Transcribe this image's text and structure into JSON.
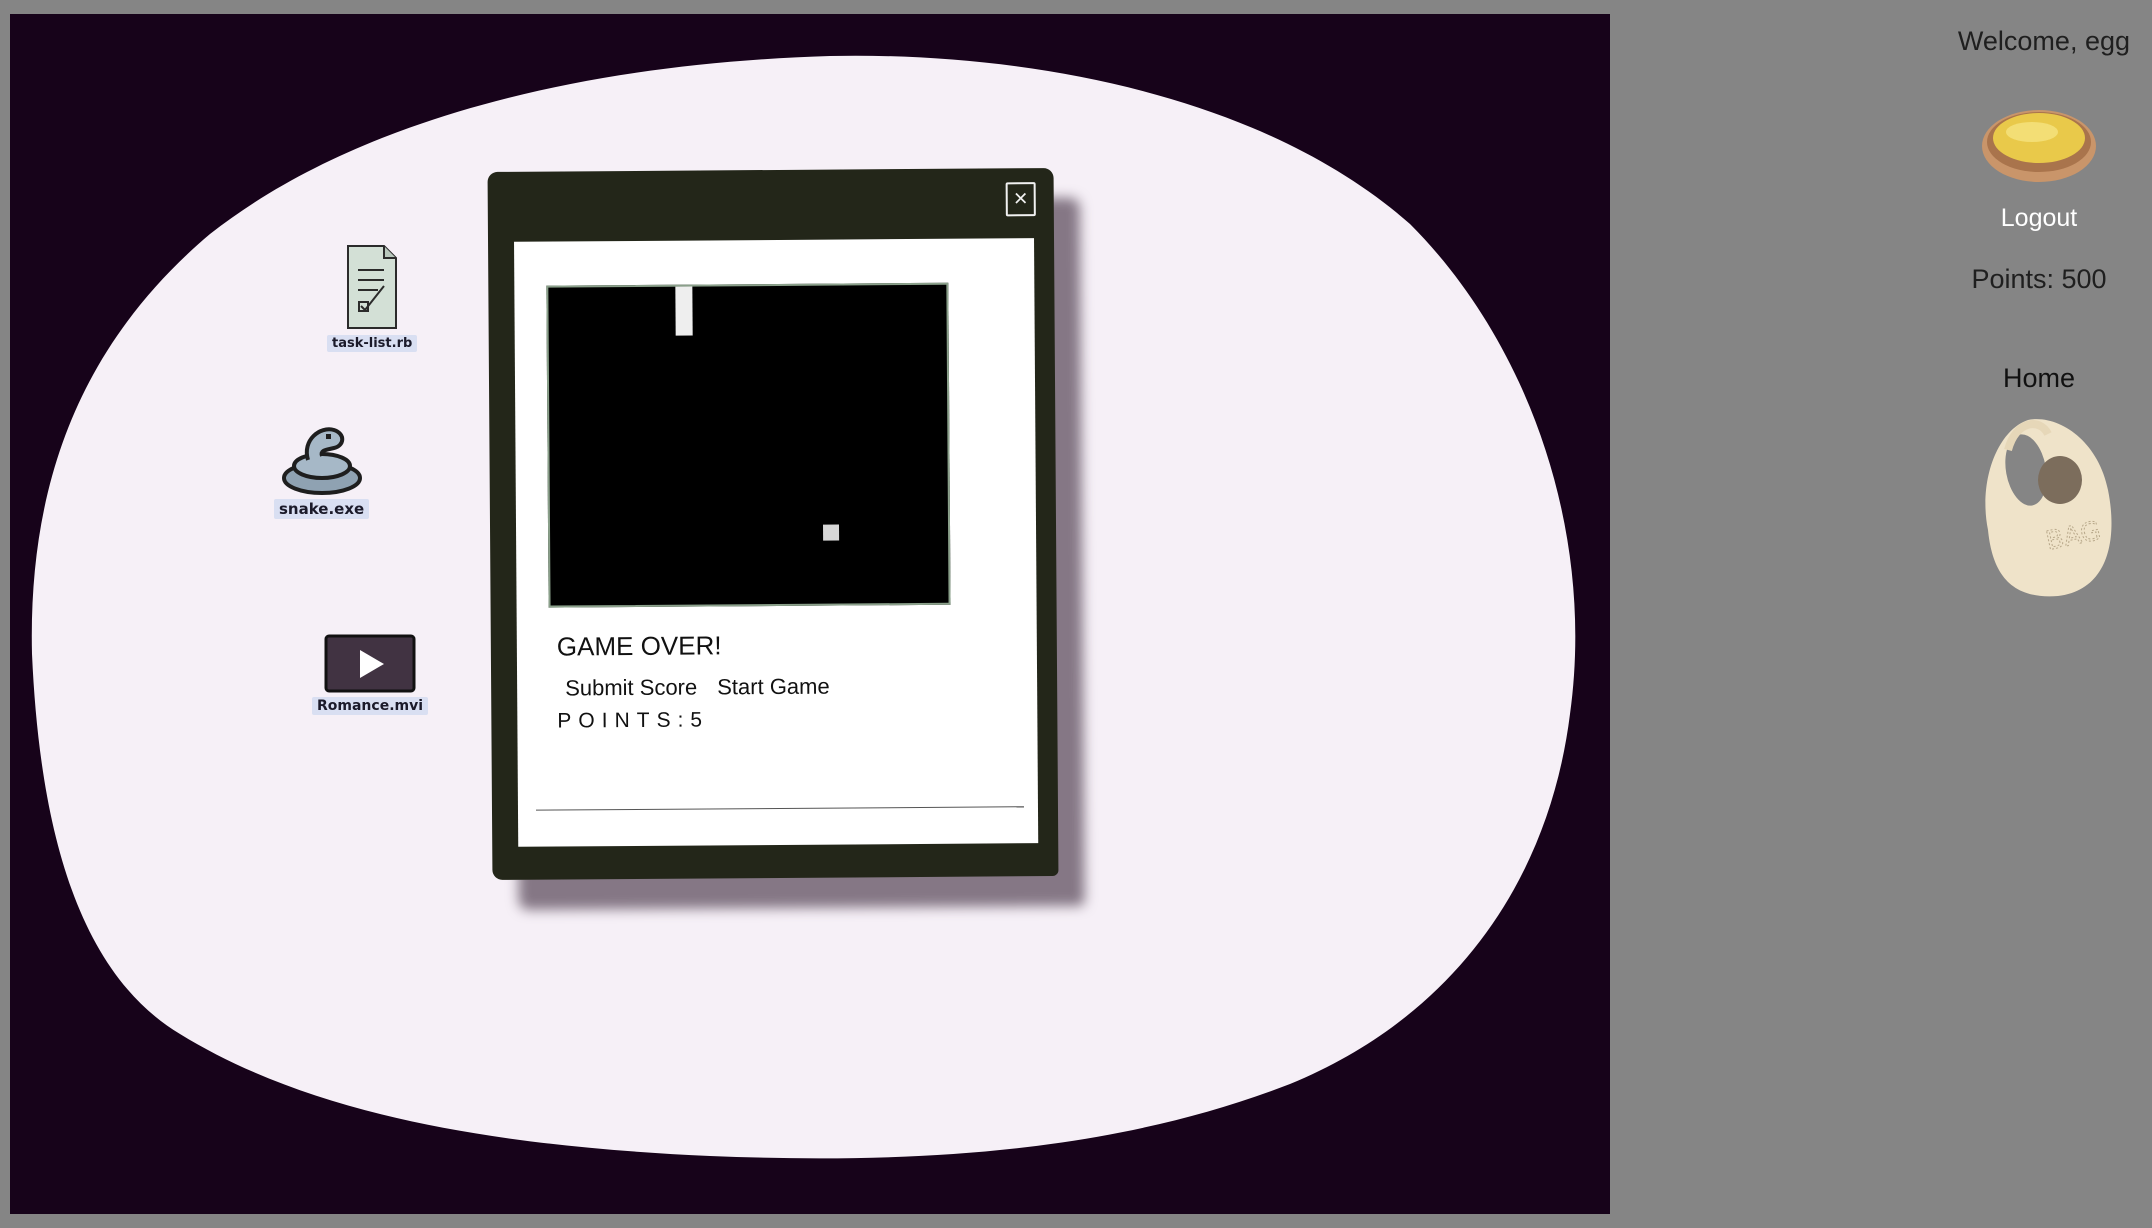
{
  "desktop": {
    "icons": [
      {
        "name": "task-list-icon",
        "label": "task-list.rb"
      },
      {
        "name": "snake-icon",
        "label": "snake.exe"
      },
      {
        "name": "video-icon",
        "label": "Romance.mvi"
      }
    ]
  },
  "game_window": {
    "close_symbol": "×",
    "status_text": "GAME OVER!",
    "submit_label": "Submit Score",
    "start_label": "Start Game",
    "points_text": "POINTS:5"
  },
  "sidebar": {
    "welcome": "Welcome, egg",
    "avatar_icon": "egg-tart-avatar",
    "logout_label": "Logout",
    "points_label": "Points: 500",
    "home_label": "Home",
    "bag_icon": "bag-icon",
    "bag_text": "BAG"
  },
  "colors": {
    "page_bg": "#858585",
    "desktop_bg": "#17031a",
    "blob": "#f6f0f7",
    "window_frame": "#232619",
    "icon_label_bg": "#d9dff2",
    "logout_text": "#ffffff"
  }
}
